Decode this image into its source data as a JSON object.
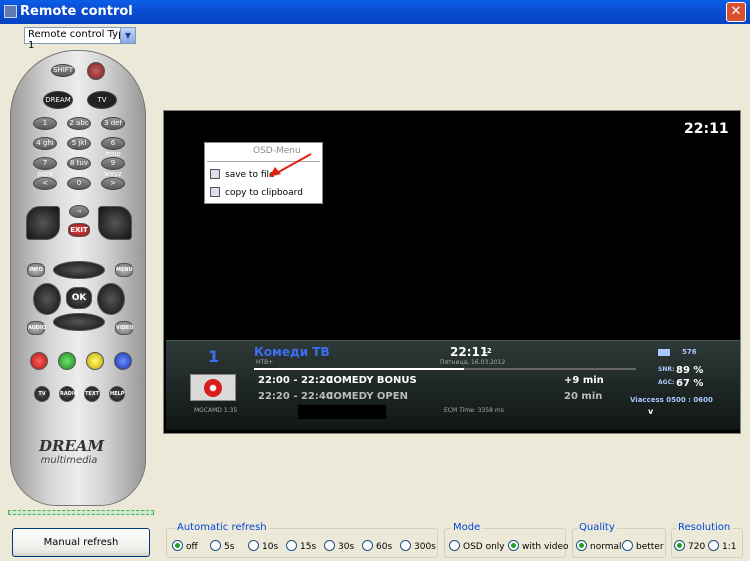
{
  "window": {
    "title": "Remote control"
  },
  "remote_type": {
    "selected": "Remote control Type 1"
  },
  "remote": {
    "shift": "SHIFT",
    "dream": "DREAM",
    "tv": "TV",
    "nums": [
      "1",
      "2 abc",
      "3 def",
      "4 ghi",
      "5 jkl",
      "6 mno",
      "7 pqrs",
      "8 tuv",
      "9 wxyz",
      "<",
      "0",
      "> "
    ],
    "exit": "EXIT",
    "ok": "OK",
    "info": "INFO",
    "menu": "MENU",
    "audio": "AUDIO",
    "video": "VIDEO",
    "bottom": [
      "TV",
      "RADIO",
      "TEXT",
      "HELP"
    ],
    "brand": "DREAM",
    "brand_sub": "multimedia"
  },
  "screen": {
    "clock": "22:11"
  },
  "context_menu": {
    "header": "OSD-Menu",
    "items": [
      "save to file",
      "copy to clipboard"
    ]
  },
  "osd": {
    "channel_num": "1",
    "channel_name": "Комеди ТВ",
    "provider": "НТВ+",
    "time": "22:11",
    "seconds": "12",
    "date": "Пятница, 16.03.2012",
    "programs": [
      {
        "time": "22:00 - 22:20",
        "title": "COMEDY BONUS",
        "remaining": "+9 min"
      },
      {
        "time": "22:20 - 22:40",
        "title": "COMEDY OPEN",
        "remaining": "20 min"
      }
    ],
    "cam": "MGCAMD 1.35",
    "ecm": "ECM Time: 3358 ms",
    "sat": "576",
    "snr_label": "SNR:",
    "snr": "89 %",
    "agc_label": "AGC:",
    "agc": "67 %",
    "ca": "Viaccess 0500 : 0600"
  },
  "controls": {
    "manual_refresh": "Manual refresh",
    "auto_refresh_label": "Automatic refresh",
    "auto_refresh": [
      "off",
      "5s",
      "10s",
      "15s",
      "30s",
      "60s",
      "300s"
    ],
    "mode_label": "Mode",
    "mode": [
      "OSD only",
      "with video"
    ],
    "quality_label": "Quality",
    "quality": [
      "normal",
      "better"
    ],
    "resolution_label": "Resolution",
    "resolution": [
      "720",
      "1:1"
    ]
  }
}
